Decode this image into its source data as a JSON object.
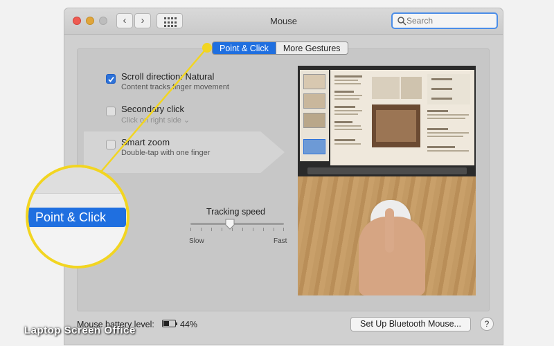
{
  "window": {
    "title": "Mouse",
    "search_placeholder": "Search"
  },
  "tabs": [
    {
      "label": "Point & Click",
      "active": true
    },
    {
      "label": "More Gestures",
      "active": false
    }
  ],
  "options": [
    {
      "title": "Scroll direction: Natural",
      "subtitle": "Content tracks finger movement",
      "checked": true
    },
    {
      "title": "Secondary click",
      "subtitle": "Click on right side ⌄",
      "checked": false
    },
    {
      "title": "Smart zoom",
      "subtitle": "Double-tap with one finger",
      "checked": false
    }
  ],
  "tracking": {
    "label": "Tracking speed",
    "min_label": "Slow",
    "max_label": "Fast",
    "level": 0.42
  },
  "callout": {
    "label": "Point & Click"
  },
  "footer": {
    "battery_label": "Mouse battery level:",
    "battery_percent": "44%",
    "setup_button": "Set Up Bluetooth Mouse...",
    "help": "?"
  },
  "watermark": "Laptop Screen Office",
  "colors": {
    "accent": "#1f6fe0",
    "callout": "#f2d521"
  }
}
